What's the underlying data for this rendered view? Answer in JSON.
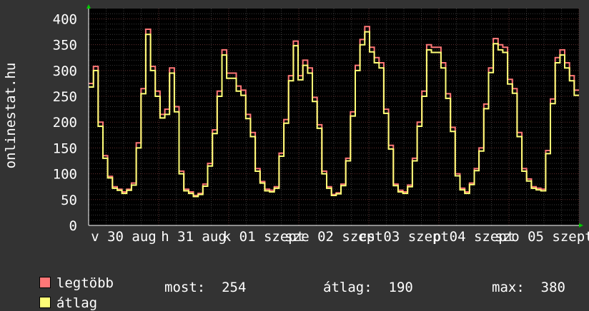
{
  "chart_data": {
    "type": "line",
    "ylabel": "onlinestat.hu",
    "ylim": [
      0,
      420
    ],
    "yticks": [
      0,
      50,
      100,
      150,
      200,
      250,
      300,
      350,
      400
    ],
    "xtick_labels": [
      "v 30 aug",
      "h 31 aug",
      "k 01 szept",
      "sze 02 szept",
      "cs 03 szept",
      "p 04 szept",
      "szo 05 szept"
    ],
    "series": [
      {
        "name": "legtöbb",
        "color": "#ff7777",
        "values": [
          275,
          308,
          200,
          135,
          95,
          75,
          70,
          65,
          70,
          82,
          160,
          265,
          380,
          308,
          260,
          215,
          225,
          305,
          230,
          105,
          70,
          65,
          58,
          62,
          80,
          120,
          185,
          260,
          340,
          295,
          295,
          270,
          262,
          215,
          180,
          110,
          85,
          70,
          68,
          75,
          140,
          205,
          290,
          357,
          290,
          320,
          305,
          248,
          195,
          105,
          75,
          60,
          63,
          80,
          130,
          220,
          310,
          360,
          385,
          345,
          325,
          315,
          225,
          155,
          80,
          68,
          65,
          78,
          130,
          200,
          260,
          350,
          345,
          345,
          315,
          255,
          190,
          100,
          72,
          65,
          82,
          110,
          150,
          235,
          305,
          362,
          350,
          345,
          283,
          265,
          180,
          110,
          90,
          75,
          72,
          70,
          145,
          245,
          325,
          340,
          315,
          290,
          262
        ]
      },
      {
        "name": "átlag",
        "color": "#ffff77",
        "values": [
          268,
          300,
          192,
          130,
          92,
          72,
          68,
          62,
          68,
          78,
          150,
          255,
          370,
          300,
          250,
          208,
          215,
          295,
          220,
          100,
          67,
          62,
          56,
          60,
          76,
          115,
          178,
          250,
          330,
          285,
          285,
          260,
          252,
          207,
          172,
          105,
          82,
          67,
          65,
          72,
          134,
          198,
          280,
          348,
          282,
          310,
          295,
          240,
          188,
          100,
          72,
          58,
          61,
          77,
          125,
          212,
          300,
          350,
          375,
          336,
          315,
          305,
          217,
          148,
          77,
          65,
          62,
          75,
          125,
          192,
          250,
          340,
          335,
          335,
          305,
          246,
          182,
          96,
          69,
          62,
          79,
          106,
          144,
          226,
          296,
          352,
          340,
          335,
          274,
          256,
          172,
          105,
          86,
          72,
          69,
          67,
          139,
          236,
          315,
          330,
          305,
          280,
          252
        ]
      }
    ]
  },
  "legend": {
    "max_label": "legtöbb",
    "avg_label": "átlag",
    "current": "most:  254",
    "average": "átlag:  190",
    "maximum": "max:  380"
  },
  "colors": {
    "background": "#333333",
    "plot_bg": "#000000",
    "grid": "#444444",
    "major_grid": "#663333",
    "axis": "#ffffff"
  }
}
